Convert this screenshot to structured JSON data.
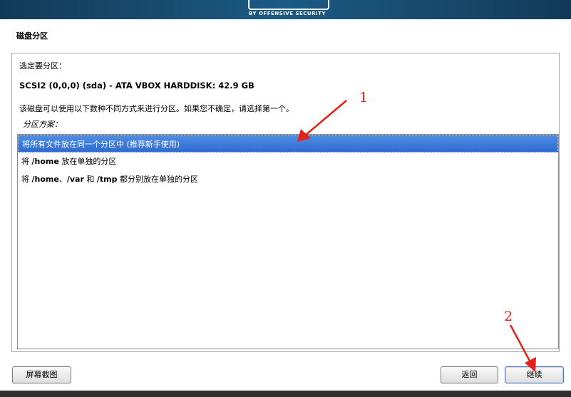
{
  "banner": {
    "logo_subtitle": "BY OFFENSIVE SECURITY"
  },
  "page_title": "磁盘分区",
  "panel": {
    "prompt": "选定要分区：",
    "disk_name": "SCSI2 (0,0,0) (sda) - ATA VBOX HARDDISK: 42.9 GB",
    "description": "该磁盘可以使用以下数种不同方式来进行分区。如果您不确定，请选择第一个。",
    "scheme_label": "分区方案："
  },
  "schemes": [
    {
      "text": "将所有文件放在同一个分区中 (推荐新手使用)",
      "selected": true
    },
    {
      "pre": "将 ",
      "b1": "/home",
      "post": " 放在单独的分区",
      "selected": false
    },
    {
      "pre": "将 ",
      "b1": "/home",
      "m1": "、",
      "b2": "/var",
      "m2": " 和 ",
      "b3": "/tmp",
      "post": " 都分别放在单独的分区",
      "selected": false
    }
  ],
  "buttons": {
    "screenshot": "屏幕截图",
    "back": "返回",
    "continue": "继续"
  },
  "annotations": {
    "one": "1",
    "two": "2"
  },
  "colors": {
    "selection": "#2f6bd0",
    "arrow": "#e52018",
    "banner": "#1b5a84"
  }
}
